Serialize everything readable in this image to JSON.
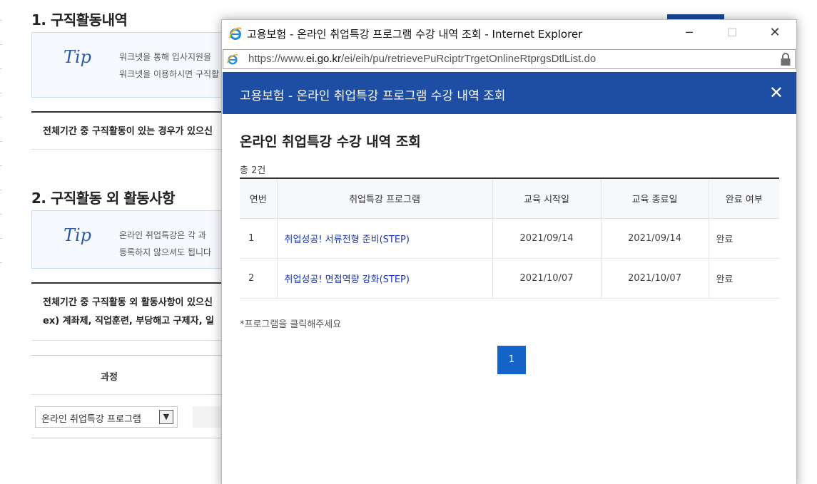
{
  "background": {
    "section1": {
      "title": "1. 구직활동내역",
      "tip_logo": "Tip",
      "tip_lines": [
        "워크넷을 통해 입사지원을",
        "워크넷을 이용하시면 구직활"
      ],
      "notice": "전체기간 중 구직활동이 있는 경우가 있으신"
    },
    "section2": {
      "title": "2. 구직활동 외 활동사항",
      "tip_logo": "Tip",
      "tip_lines": [
        "온라인 취업특강은 각 과",
        "등록하지 않으셔도 됩니다"
      ],
      "notice_lines": [
        "전체기간 중 구직활동 외 활동사항이 있으신",
        "ex) 계좌제, 직업훈련, 부당해고 구제자, 일"
      ]
    },
    "table_header": "과정",
    "course_select": {
      "value": "온라인 취업특강 프로그램"
    }
  },
  "window": {
    "title": "고용보험 - 온라인 취업특강 프로그램 수강 내역 조회 - Internet Explorer",
    "controls": {
      "minimize": "─",
      "maximize": "☐",
      "close": "✕"
    },
    "address": {
      "scheme": "https://www.",
      "domain": "ei.go.kr",
      "path": "/ei/eih/pu/retrievePuRciptrTrgetOnlineRtprgsDtlList.do"
    }
  },
  "modal": {
    "header_title": "고용보험 - 온라인 취업특강 프로그램 수강 내역 조회",
    "close": "✕",
    "content_title": "온라인 취업특강 수강 내역 조회",
    "count": "총 2건",
    "table": {
      "headers": [
        "연번",
        "취업특강 프로그램",
        "교육 시작일",
        "교육 종료일",
        "완료 여부"
      ],
      "rows": [
        {
          "no": "1",
          "program": "취업성공! 서류전형 준비(STEP)",
          "start": "2021/09/14",
          "end": "2021/09/14",
          "status": "완료"
        },
        {
          "no": "2",
          "program": "취업성공! 면접역량 강화(STEP)",
          "start": "2021/10/07",
          "end": "2021/10/07",
          "status": "완료"
        }
      ]
    },
    "note": "*프로그램을 클릭해주세요",
    "pagination": {
      "current": "1"
    }
  },
  "colors": {
    "header_blue": "#1e4ea4",
    "page_button": "#1565c8",
    "link": "#1a35b5"
  },
  "icons": [
    "ie-logo-icon",
    "lock-icon",
    "close-icon",
    "chevron-down-icon"
  ]
}
